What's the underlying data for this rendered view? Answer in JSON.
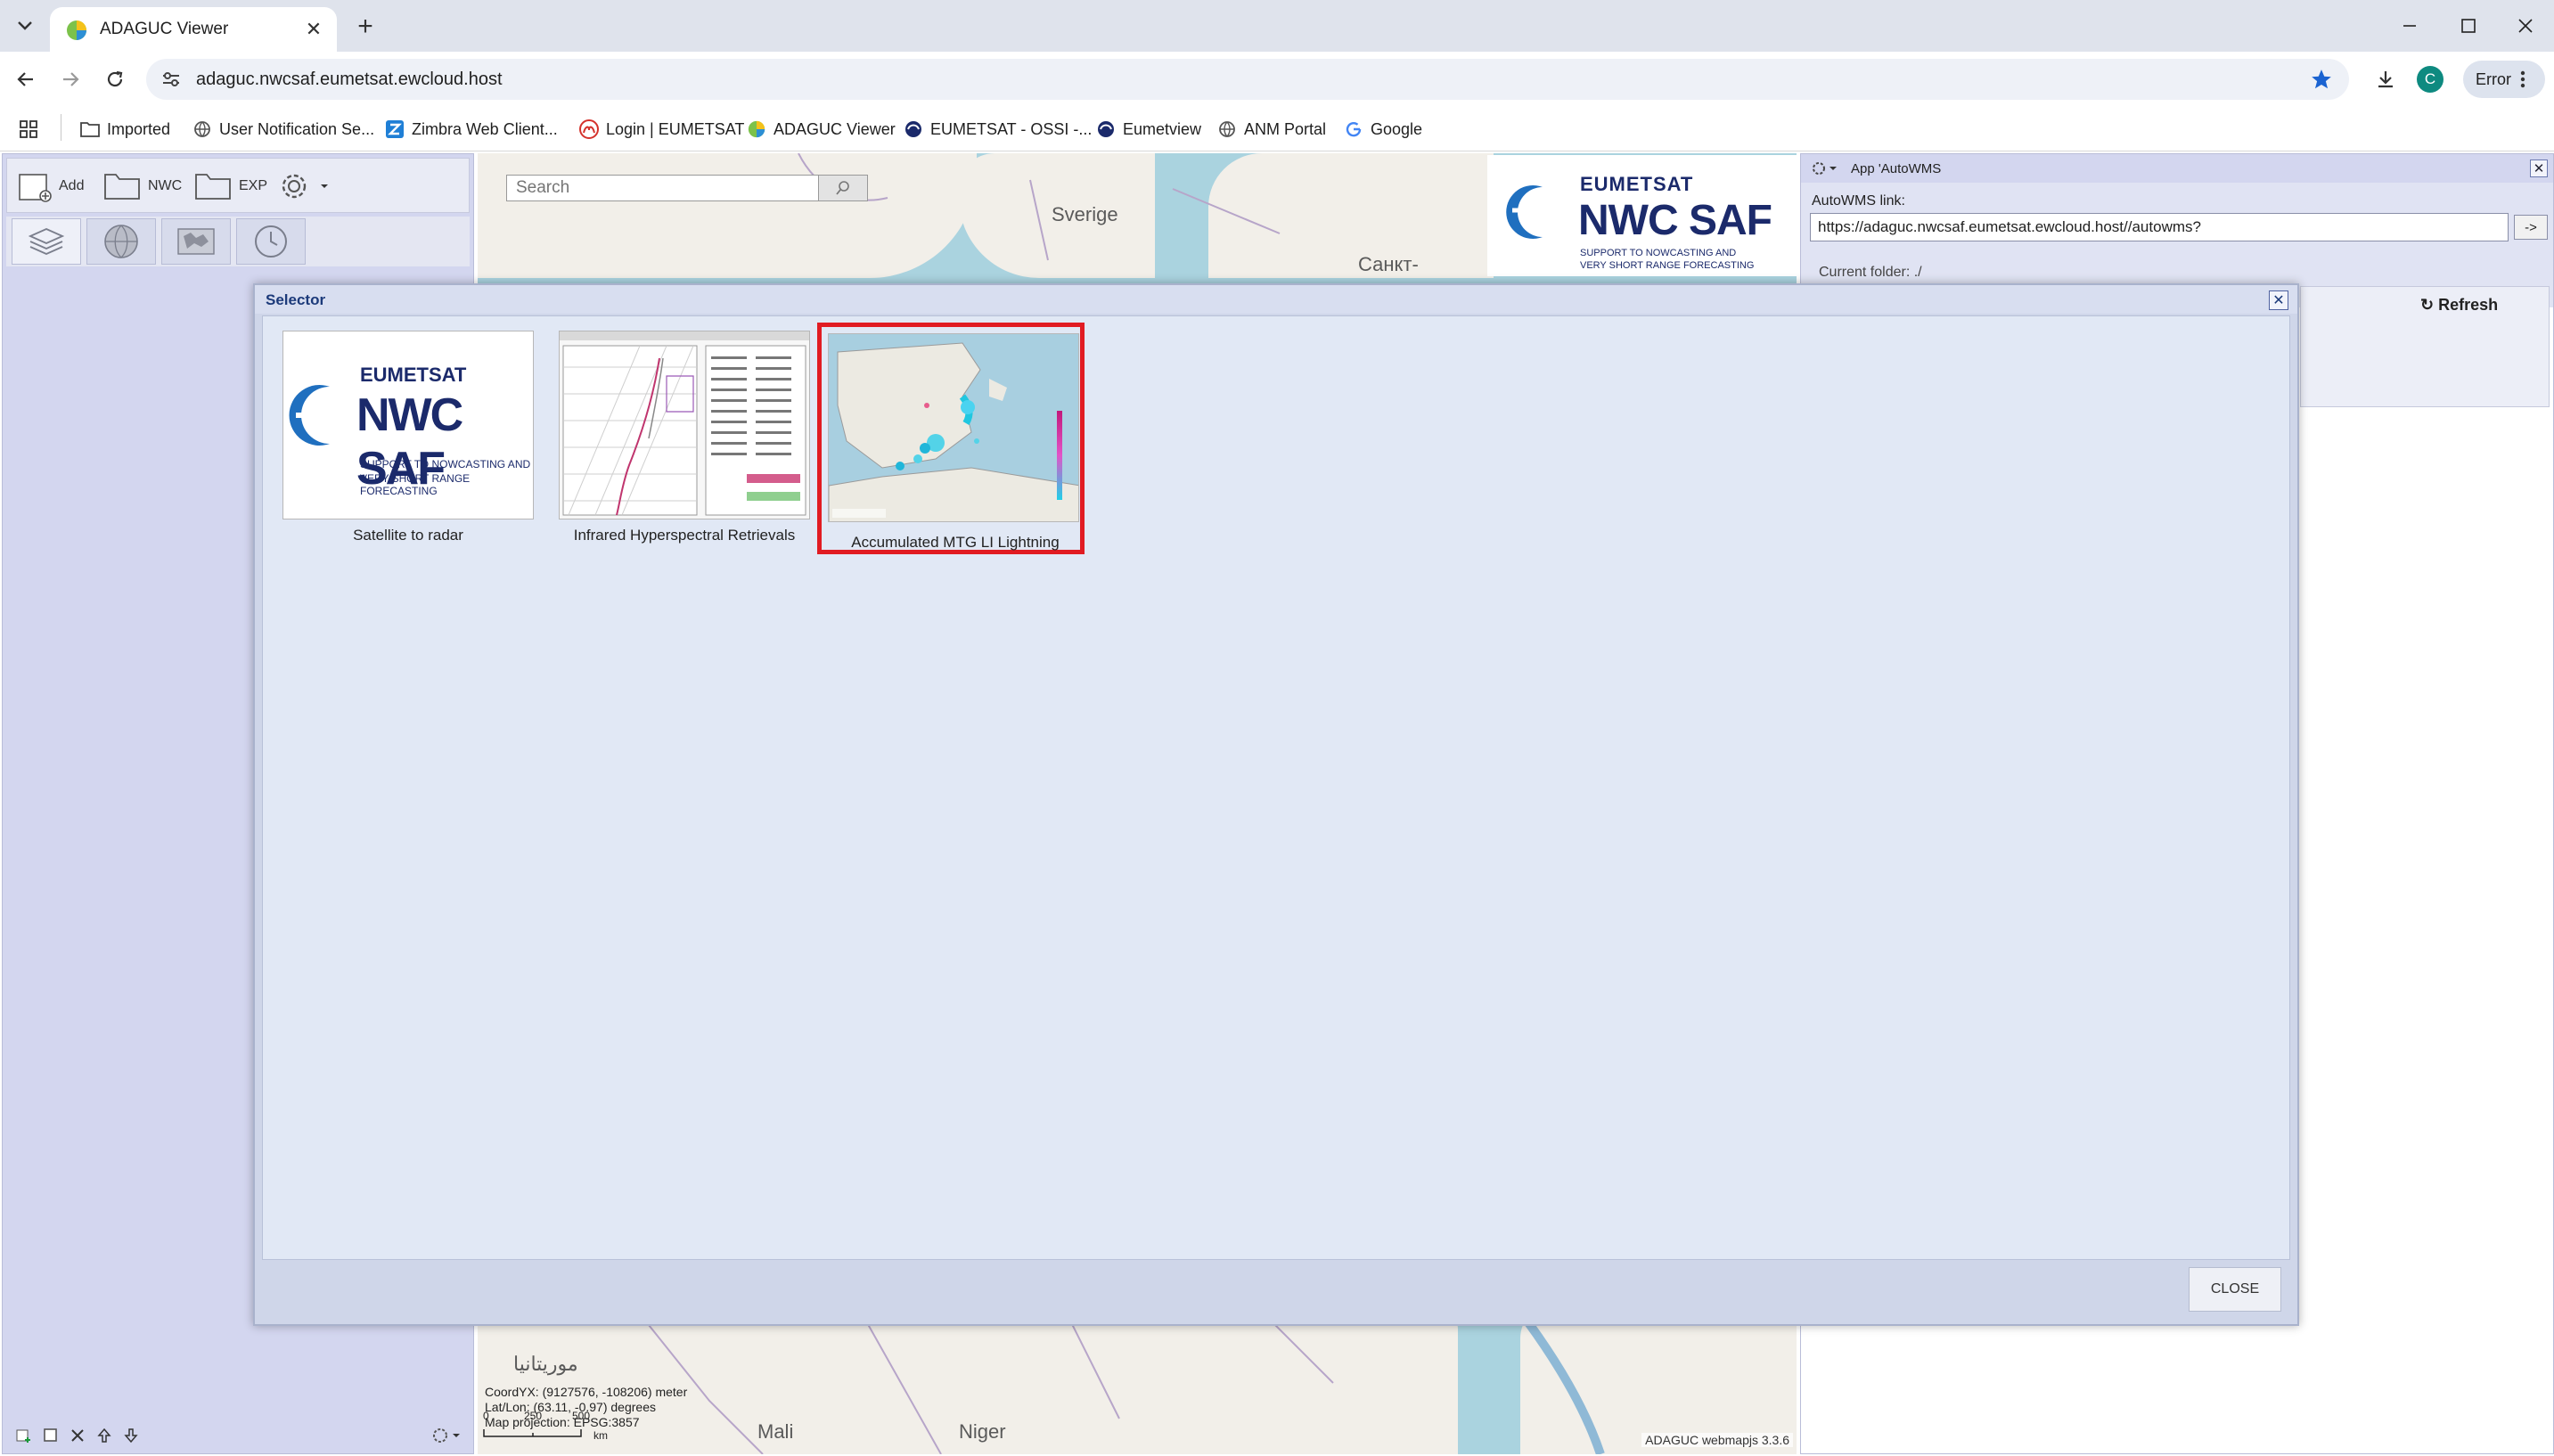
{
  "browser": {
    "tab_title": "ADAGUC Viewer",
    "url": "adaguc.nwcsaf.eumetsat.ewcloud.host",
    "profile_initial": "C",
    "error_label": "Error",
    "bookmarks": [
      {
        "label": "Imported",
        "icon": "folder-icon"
      },
      {
        "label": "User Notification Se...",
        "icon": "globe-icon"
      },
      {
        "label": "Zimbra Web Client...",
        "icon": "zimbra-icon"
      },
      {
        "label": "Login | EUMETSAT",
        "icon": "eumetsat-login-icon"
      },
      {
        "label": "ADAGUC Viewer",
        "icon": "adaguc-icon"
      },
      {
        "label": "EUMETSAT - OSSI -...",
        "icon": "eumetsat-icon"
      },
      {
        "label": "Eumetview",
        "icon": "eumetsat-icon"
      },
      {
        "label": "ANM Portal",
        "icon": "globe-icon"
      },
      {
        "label": "Google",
        "icon": "google-icon"
      }
    ]
  },
  "left_panel": {
    "add_label": "Add",
    "nwc_label": "NWC",
    "exp_label": "EXP"
  },
  "map": {
    "search_placeholder": "Search",
    "labels": {
      "sverige": "Sverige",
      "sankt": "Санкт-",
      "mauritania": "موريتانيا",
      "mali": "Mali",
      "niger": "Niger"
    },
    "coord_yx": "CoordYX: (9127576, -108206) meter",
    "lat_lon": "Lat/Lon: (63.11, -0.97) degrees",
    "projection": "Map projection: EPSG:3857",
    "scale_0": "0",
    "scale_250": "250",
    "scale_500": "500",
    "scale_unit": "km",
    "attribution": "ADAGUC webmapjs 3.3.6"
  },
  "logo": {
    "org": "EUMETSAT",
    "name": "NWC SAF",
    "tagline_1": "SUPPORT TO NOWCASTING AND",
    "tagline_2": "VERY SHORT RANGE FORECASTING"
  },
  "right_panel": {
    "title": "App 'AutoWMS",
    "link_label": "AutoWMS link:",
    "link_value": "https://adaguc.nwcsaf.eumetsat.ewcloud.host//autowms?",
    "go_label": "->",
    "current_folder": "Current folder: ./",
    "refresh_label": "↻ Refresh"
  },
  "selector": {
    "title": "Selector",
    "close_label": "CLOSE",
    "items": [
      {
        "caption": "Satellite to radar",
        "selected": false
      },
      {
        "caption": "Infrared Hyperspectral Retrievals",
        "selected": false
      },
      {
        "caption": "Accumulated MTG LI Lightning",
        "selected": true
      }
    ]
  },
  "colors": {
    "selection_border": "#e11b22",
    "brand_navy": "#1b2a6b",
    "brand_blue": "#1f6fbf"
  }
}
